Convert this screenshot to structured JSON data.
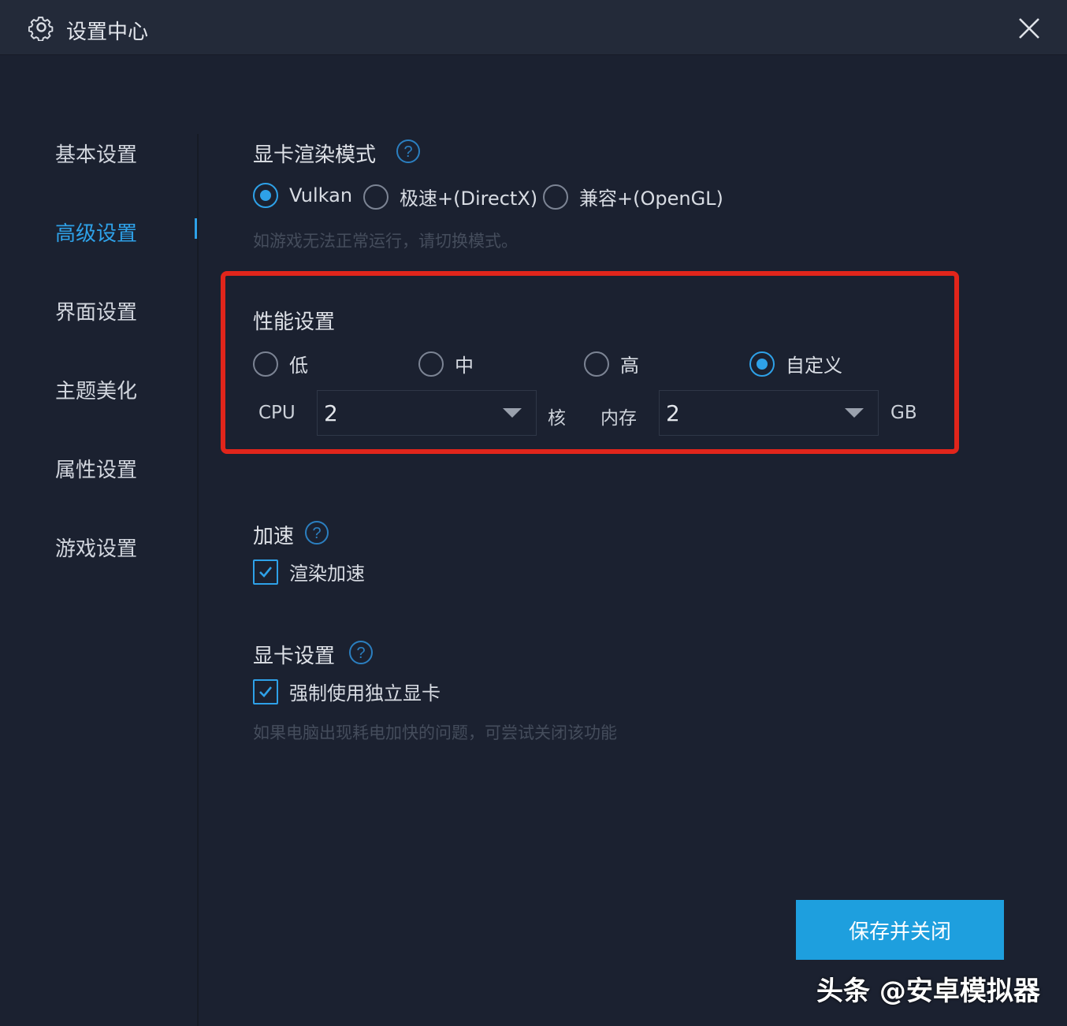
{
  "window": {
    "title": "设置中心"
  },
  "sidebar": {
    "items": [
      {
        "label": "基本设置"
      },
      {
        "label": "高级设置",
        "active": true
      },
      {
        "label": "界面设置"
      },
      {
        "label": "主题美化"
      },
      {
        "label": "属性设置"
      },
      {
        "label": "游戏设置"
      }
    ]
  },
  "render_mode": {
    "title": "显卡渲染模式",
    "options": [
      {
        "label": "Vulkan",
        "checked": true
      },
      {
        "label": "极速+(DirectX)",
        "checked": false
      },
      {
        "label": "兼容+(OpenGL)",
        "checked": false
      }
    ],
    "hint": "如游戏无法正常运行，请切换模式。"
  },
  "performance": {
    "title": "性能设置",
    "options": [
      {
        "label": "低",
        "checked": false
      },
      {
        "label": "中",
        "checked": false
      },
      {
        "label": "高",
        "checked": false
      },
      {
        "label": "自定义",
        "checked": true
      }
    ],
    "cpu_label": "CPU",
    "cpu_value": "2",
    "cpu_unit": "核",
    "memory_label": "内存",
    "memory_value": "2",
    "memory_unit": "GB"
  },
  "acceleration": {
    "title": "加速",
    "option": {
      "label": "渲染加速",
      "checked": true
    }
  },
  "gpu": {
    "title": "显卡设置",
    "option": {
      "label": "强制使用独立显卡",
      "checked": true
    },
    "hint": "如果电脑出现耗电加快的问题，可尝试关闭该功能"
  },
  "footer": {
    "save_label": "保存并关闭"
  },
  "watermark": "头条 @安卓模拟器",
  "colors": {
    "accent": "#2ea1e8",
    "background": "#1b2130",
    "highlight_box": "#e1251b",
    "button": "#1e9fde"
  }
}
